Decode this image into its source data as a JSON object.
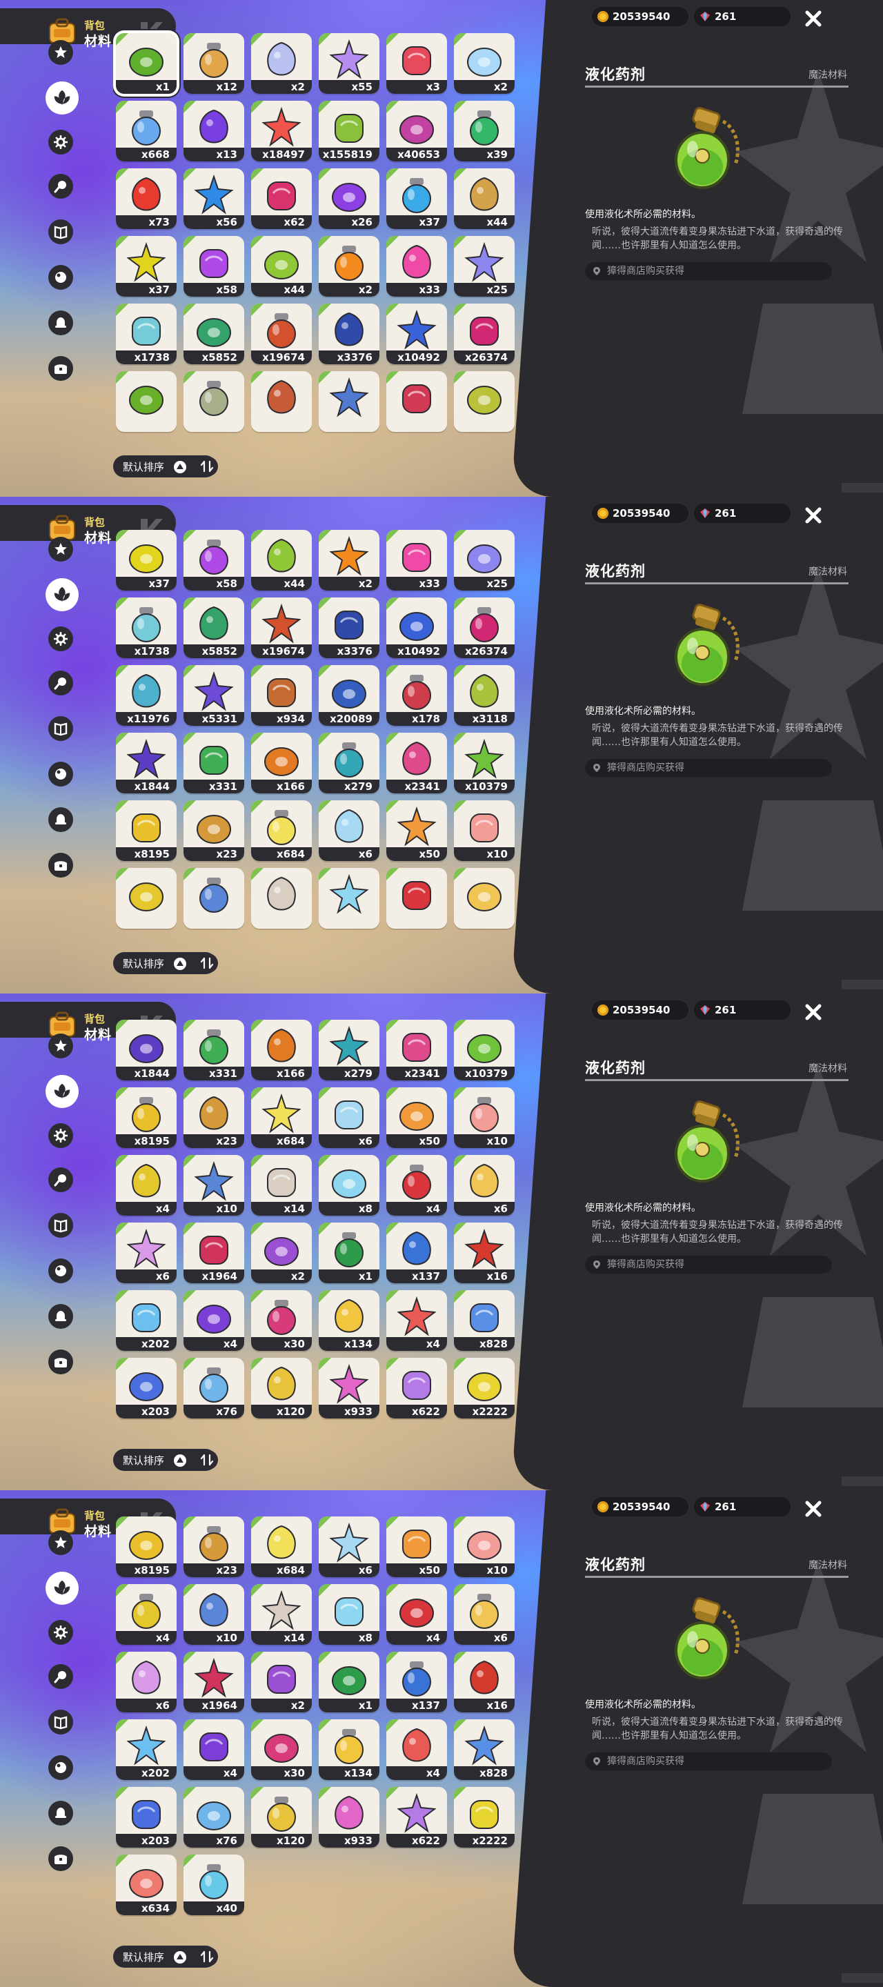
{
  "header": {
    "title_small": "背包",
    "title_big": "材料"
  },
  "categories": [
    {
      "name": "star-tab",
      "icon": "star-icon"
    },
    {
      "name": "materials-tab",
      "icon": "leaf-icon",
      "active": true
    },
    {
      "name": "gear-tab",
      "icon": "gear-icon"
    },
    {
      "name": "food-tab",
      "icon": "drumstick-icon"
    },
    {
      "name": "book-tab",
      "icon": "book-icon"
    },
    {
      "name": "orb-tab",
      "icon": "orb-icon"
    },
    {
      "name": "bell-tab",
      "icon": "bell-icon"
    },
    {
      "name": "chest-tab",
      "icon": "chest-icon"
    }
  ],
  "sort": {
    "label": "默认排序"
  },
  "resources": {
    "coins": "20539540",
    "gems": "261"
  },
  "detail": {
    "name": "液化药剂",
    "category": "魔法材料",
    "description": "使用液化术所必需的材料。",
    "lore": "听说，彼得大道流传着变身果冻钻进下水道，获得奇遇的传闻……也许那里有人知道怎么使用。",
    "source": "獐得商店购买获得"
  },
  "frames": [
    {
      "rows": [
        [
          {
            "c": "x1",
            "col": "#5fb02c",
            "sel": true
          },
          {
            "c": "x12",
            "col": "#e1a64a"
          },
          {
            "c": "x2",
            "col": "#b9c1f1"
          },
          {
            "c": "x55",
            "col": "#b58cf0"
          },
          {
            "c": "x3",
            "col": "#e64a5c"
          },
          {
            "c": "x2",
            "col": "#a9d8f8"
          }
        ],
        [
          {
            "c": "x668",
            "col": "#69a9ef"
          },
          {
            "c": "x13",
            "col": "#7a3fe0"
          },
          {
            "c": "x18497",
            "col": "#f0544a"
          },
          {
            "c": "x155819",
            "col": "#8ac03a"
          },
          {
            "c": "x40653",
            "col": "#c142a0"
          },
          {
            "c": "x39",
            "col": "#33b86a"
          }
        ],
        [
          {
            "c": "x73",
            "col": "#e83b2f"
          },
          {
            "c": "x56",
            "col": "#2f8be6"
          },
          {
            "c": "x62",
            "col": "#d9336e"
          },
          {
            "c": "x26",
            "col": "#8c3fe3"
          },
          {
            "c": "x37",
            "col": "#3aa9e8"
          },
          {
            "c": "x44",
            "col": "#d3a34b"
          }
        ],
        [
          {
            "c": "x37",
            "col": "#e2d31c"
          },
          {
            "c": "x58",
            "col": "#b04ae6"
          },
          {
            "c": "x44",
            "col": "#8fc737"
          },
          {
            "c": "x2",
            "col": "#f28a1d"
          },
          {
            "c": "x33",
            "col": "#ee4aa6"
          },
          {
            "c": "x25",
            "col": "#8e86ef"
          }
        ],
        [
          {
            "c": "x1738",
            "col": "#76cbd9"
          },
          {
            "c": "x5852",
            "col": "#35a26a"
          },
          {
            "c": "x19674",
            "col": "#d4512e"
          },
          {
            "c": "x3376",
            "col": "#2f4aa8"
          },
          {
            "c": "x10492",
            "col": "#3a62d8"
          },
          {
            "c": "x26374",
            "col": "#d22873"
          }
        ],
        [
          {
            "c": "",
            "col": "#6ab02a"
          },
          {
            "c": "",
            "col": "#a7b08a"
          },
          {
            "c": "",
            "col": "#c85c38"
          },
          {
            "c": "",
            "col": "#4f7ad0"
          },
          {
            "c": "",
            "col": "#d03a55"
          },
          {
            "c": "",
            "col": "#b9c23a"
          }
        ]
      ],
      "offset": 48
    },
    {
      "rows": [
        [
          {
            "c": "x37",
            "col": "#e2d31c"
          },
          {
            "c": "x58",
            "col": "#b04ae6"
          },
          {
            "c": "x44",
            "col": "#8fc737"
          },
          {
            "c": "x2",
            "col": "#f28a1d"
          },
          {
            "c": "x33",
            "col": "#ee4aa6"
          },
          {
            "c": "x25",
            "col": "#8e86ef"
          }
        ],
        [
          {
            "c": "x1738",
            "col": "#76cbd9"
          },
          {
            "c": "x5852",
            "col": "#35a26a"
          },
          {
            "c": "x19674",
            "col": "#d4512e"
          },
          {
            "c": "x3376",
            "col": "#2f4aa8"
          },
          {
            "c": "x10492",
            "col": "#3a62d8"
          },
          {
            "c": "x26374",
            "col": "#d22873"
          }
        ],
        [
          {
            "c": "x11976",
            "col": "#4db1ce"
          },
          {
            "c": "x5331",
            "col": "#6d4ad8"
          },
          {
            "c": "x934",
            "col": "#c56a33"
          },
          {
            "c": "x20089",
            "col": "#355fbf"
          },
          {
            "c": "x178",
            "col": "#cf3d4a"
          },
          {
            "c": "x3118",
            "col": "#a9c23b"
          }
        ],
        [
          {
            "c": "x1844",
            "col": "#5d3dc4"
          },
          {
            "c": "x331",
            "col": "#3fae54"
          },
          {
            "c": "x166",
            "col": "#e27a23"
          },
          {
            "c": "x279",
            "col": "#33a6b5"
          },
          {
            "c": "x2341",
            "col": "#df4a8d"
          },
          {
            "c": "x10379",
            "col": "#6fc23a"
          }
        ],
        [
          {
            "c": "x8195",
            "col": "#e9c02c"
          },
          {
            "c": "x23",
            "col": "#d49a3a"
          },
          {
            "c": "x684",
            "col": "#f3e05a"
          },
          {
            "c": "x6",
            "col": "#a8d9f2"
          },
          {
            "c": "x50",
            "col": "#f09a3b"
          },
          {
            "c": "x10",
            "col": "#f39d98"
          }
        ],
        [
          {
            "c": "",
            "col": "#e4c72c"
          },
          {
            "c": "",
            "col": "#5a86d8"
          },
          {
            "c": "",
            "col": "#d8cfc2"
          },
          {
            "c": "",
            "col": "#8fd6f0"
          },
          {
            "c": "",
            "col": "#d8363c"
          },
          {
            "c": "",
            "col": "#f0c553"
          }
        ]
      ],
      "offset": 48
    },
    {
      "rows": [
        [
          {
            "c": "x1844",
            "col": "#5d3dc4"
          },
          {
            "c": "x331",
            "col": "#3fae54"
          },
          {
            "c": "x166",
            "col": "#e27a23"
          },
          {
            "c": "x279",
            "col": "#33a6b5"
          },
          {
            "c": "x2341",
            "col": "#df4a8d"
          },
          {
            "c": "x10379",
            "col": "#6fc23a"
          }
        ],
        [
          {
            "c": "x8195",
            "col": "#e9c02c"
          },
          {
            "c": "x23",
            "col": "#d49a3a"
          },
          {
            "c": "x684",
            "col": "#f3e05a"
          },
          {
            "c": "x6",
            "col": "#a8d9f2"
          },
          {
            "c": "x50",
            "col": "#f09a3b"
          },
          {
            "c": "x10",
            "col": "#f39d98"
          }
        ],
        [
          {
            "c": "x4",
            "col": "#e4c72c"
          },
          {
            "c": "x10",
            "col": "#5a86d8"
          },
          {
            "c": "x14",
            "col": "#d8cfc2"
          },
          {
            "c": "x8",
            "col": "#8fd6f0"
          },
          {
            "c": "x4",
            "col": "#d8363c"
          },
          {
            "c": "x6",
            "col": "#f0c553"
          }
        ],
        [
          {
            "c": "x6",
            "col": "#d99ae8"
          },
          {
            "c": "x1964",
            "col": "#d0335b"
          },
          {
            "c": "x2",
            "col": "#9b4fd3"
          },
          {
            "c": "x1",
            "col": "#2e9b4a"
          },
          {
            "c": "x137",
            "col": "#3a73d8"
          },
          {
            "c": "x16",
            "col": "#d63a2e"
          }
        ],
        [
          {
            "c": "x202",
            "col": "#6cc0f0"
          },
          {
            "c": "x4",
            "col": "#7b3fd8"
          },
          {
            "c": "x30",
            "col": "#d73b7a"
          },
          {
            "c": "x134",
            "col": "#f2c53f"
          },
          {
            "c": "x4",
            "col": "#ea5a54"
          },
          {
            "c": "x828",
            "col": "#5a8fe6"
          }
        ],
        [
          {
            "c": "x203",
            "col": "#4b6fe0"
          },
          {
            "c": "x76",
            "col": "#6fb5ea"
          },
          {
            "c": "x120",
            "col": "#e7c43b"
          },
          {
            "c": "x933",
            "col": "#e266c8"
          },
          {
            "c": "x622",
            "col": "#b47be6"
          },
          {
            "c": "x2222",
            "col": "#e8d431"
          }
        ]
      ],
      "offset": 38
    },
    {
      "rows": [
        [
          {
            "c": "x8195",
            "col": "#e9c02c"
          },
          {
            "c": "x23",
            "col": "#d49a3a"
          },
          {
            "c": "x684",
            "col": "#f3e05a"
          },
          {
            "c": "x6",
            "col": "#a8d9f2"
          },
          {
            "c": "x50",
            "col": "#f09a3b"
          },
          {
            "c": "x10",
            "col": "#f39d98"
          }
        ],
        [
          {
            "c": "x4",
            "col": "#e4c72c"
          },
          {
            "c": "x10",
            "col": "#5a86d8"
          },
          {
            "c": "x14",
            "col": "#d8cfc2"
          },
          {
            "c": "x8",
            "col": "#8fd6f0"
          },
          {
            "c": "x4",
            "col": "#d8363c"
          },
          {
            "c": "x6",
            "col": "#f0c553"
          }
        ],
        [
          {
            "c": "x6",
            "col": "#d99ae8"
          },
          {
            "c": "x1964",
            "col": "#d0335b"
          },
          {
            "c": "x2",
            "col": "#9b4fd3"
          },
          {
            "c": "x1",
            "col": "#2e9b4a"
          },
          {
            "c": "x137",
            "col": "#3a73d8"
          },
          {
            "c": "x16",
            "col": "#d63a2e"
          }
        ],
        [
          {
            "c": "x202",
            "col": "#6cc0f0"
          },
          {
            "c": "x4",
            "col": "#7b3fd8"
          },
          {
            "c": "x30",
            "col": "#d73b7a"
          },
          {
            "c": "x134",
            "col": "#f2c53f"
          },
          {
            "c": "x4",
            "col": "#ea5a54"
          },
          {
            "c": "x828",
            "col": "#5a8fe6"
          }
        ],
        [
          {
            "c": "x203",
            "col": "#4b6fe0"
          },
          {
            "c": "x76",
            "col": "#6fb5ea"
          },
          {
            "c": "x120",
            "col": "#e7c43b"
          },
          {
            "c": "x933",
            "col": "#e266c8"
          },
          {
            "c": "x622",
            "col": "#b47be6"
          },
          {
            "c": "x2222",
            "col": "#e8d431"
          }
        ],
        [
          {
            "c": "x634",
            "col": "#ef7a6f"
          },
          {
            "c": "x40",
            "col": "#67c9e8"
          }
        ]
      ],
      "offset": 38
    }
  ]
}
